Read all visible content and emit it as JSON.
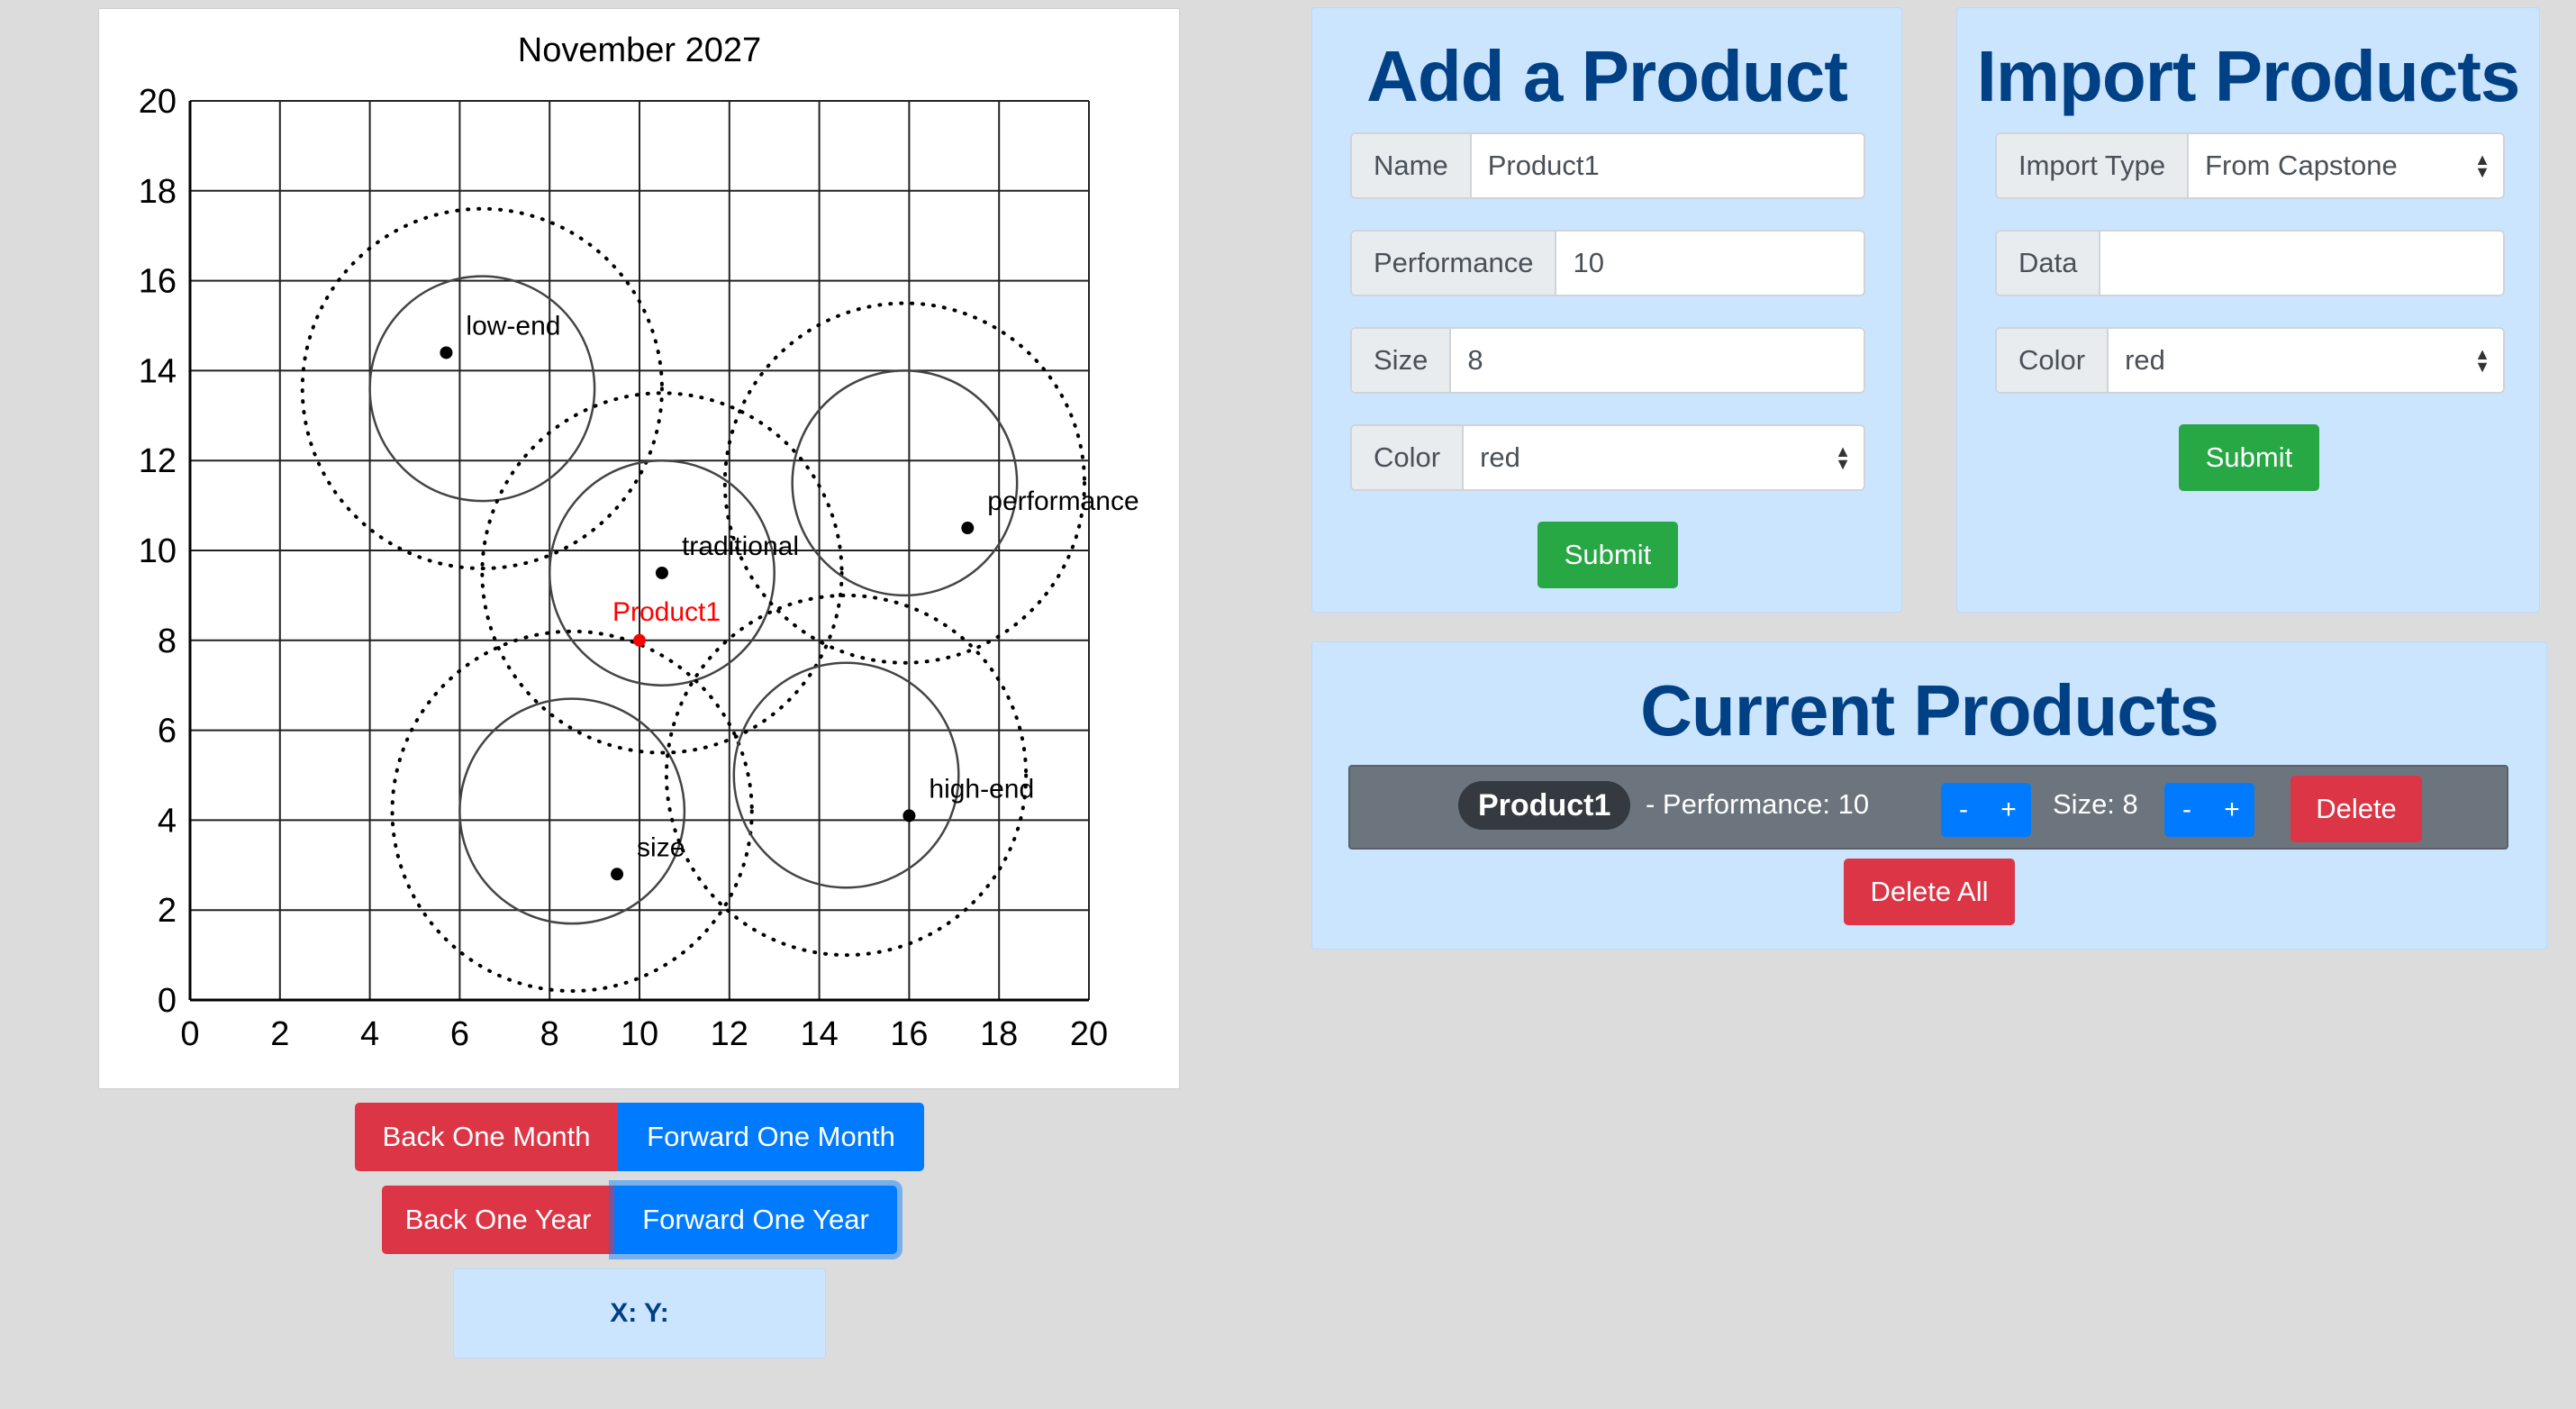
{
  "chart_data": {
    "type": "scatter",
    "title": "November 2027",
    "xlim": [
      0,
      20
    ],
    "ylim": [
      0,
      20
    ],
    "x_ticks": [
      "0",
      "2",
      "4",
      "6",
      "8",
      "10",
      "12",
      "14",
      "16",
      "18",
      "20"
    ],
    "y_ticks": [
      "0",
      "2",
      "4",
      "6",
      "8",
      "10",
      "12",
      "14",
      "16",
      "18",
      "20"
    ],
    "grid": true,
    "segments": [
      {
        "name": "low-end",
        "x": 5.7,
        "y": 14.4,
        "center": [
          6.5,
          13.6
        ],
        "inner_radius": 2.5,
        "outer_radius": 4.0
      },
      {
        "name": "traditional",
        "x": 10.5,
        "y": 9.5,
        "center": [
          10.5,
          9.5
        ],
        "inner_radius": 2.5,
        "outer_radius": 4.0
      },
      {
        "name": "performance",
        "x": 17.3,
        "y": 10.5,
        "center": [
          15.9,
          11.5
        ],
        "inner_radius": 2.5,
        "outer_radius": 4.0
      },
      {
        "name": "size",
        "x": 9.5,
        "y": 2.8,
        "center": [
          8.5,
          4.2
        ],
        "inner_radius": 2.5,
        "outer_radius": 4.0
      },
      {
        "name": "high-end",
        "x": 16.0,
        "y": 4.1,
        "center": [
          14.6,
          5.0
        ],
        "inner_radius": 2.5,
        "outer_radius": 4.0
      }
    ],
    "products": [
      {
        "name": "Product1",
        "x": 10,
        "y": 8,
        "color": "#ff0000"
      }
    ]
  },
  "controls": {
    "back_month": "Back One Month",
    "forward_month": "Forward One Month",
    "back_year": "Back One Year",
    "forward_year": "Forward One Year",
    "coords": "X: Y:"
  },
  "add_product": {
    "title": "Add a Product",
    "name_label": "Name",
    "name_value": "Product1",
    "performance_label": "Performance",
    "performance_value": "10",
    "size_label": "Size",
    "size_value": "8",
    "color_label": "Color",
    "color_value": "red",
    "submit": "Submit"
  },
  "import_products": {
    "title": "Import Products",
    "type_label": "Import Type",
    "type_value": "From Capstone",
    "data_label": "Data",
    "data_value": "",
    "color_label": "Color",
    "color_value": "red",
    "submit": "Submit"
  },
  "current_products": {
    "title": "Current Products",
    "items": [
      {
        "name": "Product1",
        "performance_text": "- Performance: 10",
        "size_text": "Size: 8",
        "minus": "-",
        "plus": "+",
        "delete": "Delete"
      }
    ],
    "delete_all": "Delete All"
  },
  "colors": {
    "accent_blue": "#007bff",
    "danger_red": "#dc3545",
    "success_green": "#28a745",
    "card_bg": "#cce5ff",
    "title_blue": "#004085"
  }
}
